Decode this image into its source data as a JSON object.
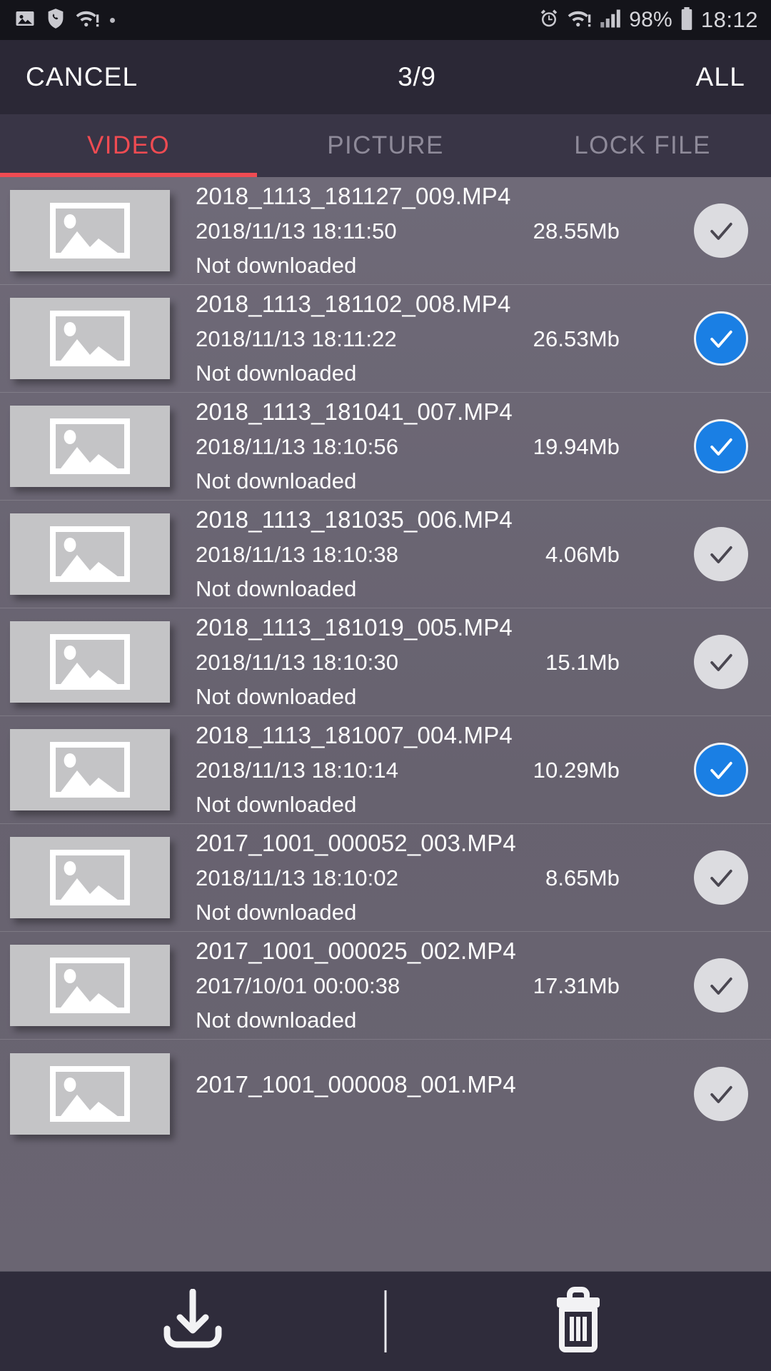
{
  "status_bar": {
    "left_icons": [
      "image-icon",
      "call-shield-icon",
      "wifi-alert-icon",
      "dot-icon"
    ],
    "right_icons": [
      "alarm-icon",
      "wifi-alert-icon",
      "signal-bars-icon",
      "battery-icon"
    ],
    "battery_percent": "98%",
    "time": "18:12"
  },
  "header": {
    "cancel_label": "CANCEL",
    "count_label": "3/9",
    "all_label": "ALL"
  },
  "tabs": [
    {
      "label": "VIDEO",
      "active": true
    },
    {
      "label": "PICTURE",
      "active": false
    },
    {
      "label": "LOCK FILE",
      "active": false
    }
  ],
  "accent_color": "#ef4b52",
  "selected_color": "#1a7fe4",
  "files": [
    {
      "name": "2018_1113_181127_009.MP4",
      "date": "2018/11/13 18:11:50",
      "size": "28.55Mb",
      "state": "Not downloaded",
      "selected": false
    },
    {
      "name": "2018_1113_181102_008.MP4",
      "date": "2018/11/13 18:11:22",
      "size": "26.53Mb",
      "state": "Not downloaded",
      "selected": true
    },
    {
      "name": "2018_1113_181041_007.MP4",
      "date": "2018/11/13 18:10:56",
      "size": "19.94Mb",
      "state": "Not downloaded",
      "selected": true
    },
    {
      "name": "2018_1113_181035_006.MP4",
      "date": "2018/11/13 18:10:38",
      "size": "4.06Mb",
      "state": "Not downloaded",
      "selected": false
    },
    {
      "name": "2018_1113_181019_005.MP4",
      "date": "2018/11/13 18:10:30",
      "size": "15.1Mb",
      "state": "Not downloaded",
      "selected": false
    },
    {
      "name": "2018_1113_181007_004.MP4",
      "date": "2018/11/13 18:10:14",
      "size": "10.29Mb",
      "state": "Not downloaded",
      "selected": true
    },
    {
      "name": "2017_1001_000052_003.MP4",
      "date": "2018/11/13 18:10:02",
      "size": "8.65Mb",
      "state": "Not downloaded",
      "selected": false
    },
    {
      "name": "2017_1001_000025_002.MP4",
      "date": "2017/10/01 00:00:38",
      "size": "17.31Mb",
      "state": "Not downloaded",
      "selected": false
    },
    {
      "name": "2017_1001_000008_001.MP4",
      "date": "",
      "size": "",
      "state": "",
      "selected": false
    }
  ],
  "bottom_bar": {
    "download_icon": "download-icon",
    "delete_icon": "trash-icon"
  }
}
